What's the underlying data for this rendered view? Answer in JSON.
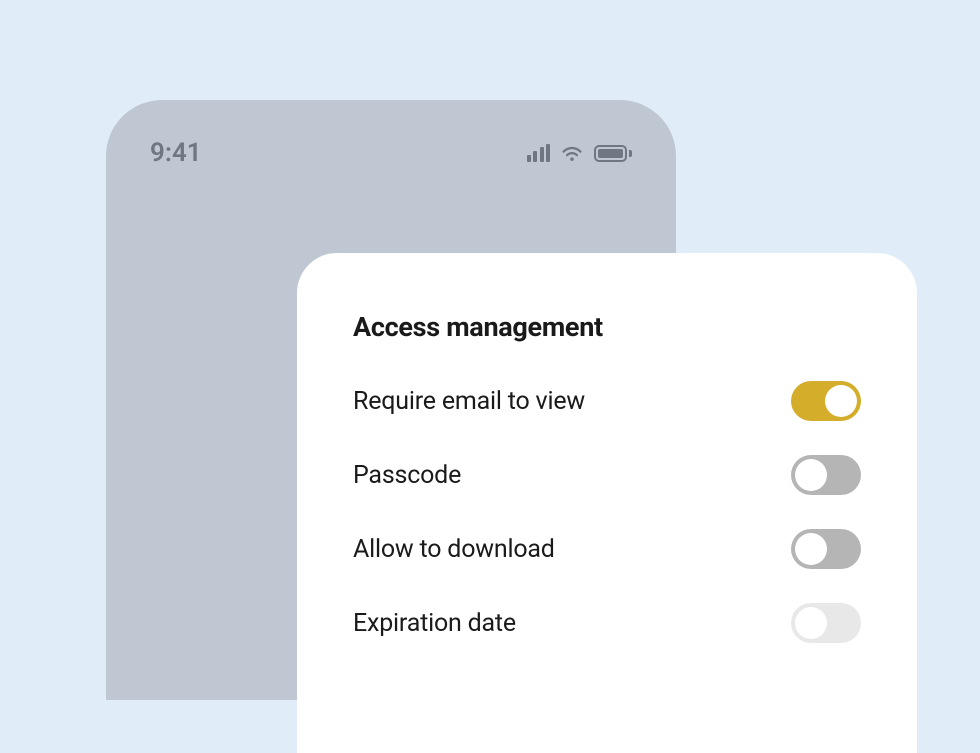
{
  "statusBar": {
    "time": "9:41"
  },
  "accessManagement": {
    "title": "Access management",
    "settings": [
      {
        "label": "Require email to view",
        "enabled": true
      },
      {
        "label": "Passcode",
        "enabled": false
      },
      {
        "label": "Allow to download",
        "enabled": false
      },
      {
        "label": "Expiration date",
        "enabled": false
      }
    ]
  }
}
